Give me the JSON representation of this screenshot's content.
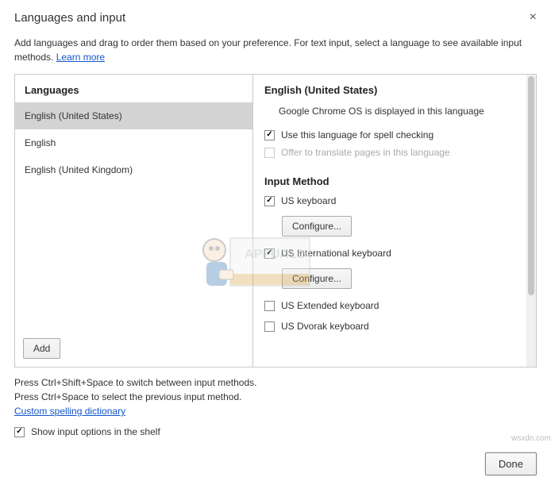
{
  "header": {
    "title": "Languages and input",
    "subtitle_prefix": "Add languages and drag to order them based on your preference. For text input, select a language to see available input methods. ",
    "learn_more": "Learn more"
  },
  "left": {
    "heading": "Languages",
    "items": [
      {
        "label": "English (United States)",
        "selected": true
      },
      {
        "label": "English",
        "selected": false
      },
      {
        "label": "English (United Kingdom)",
        "selected": false
      }
    ],
    "add_label": "Add"
  },
  "right": {
    "title": "English (United States)",
    "display_msg": "Google Chrome OS is displayed in this language",
    "spell_label": "Use this language for spell checking",
    "translate_label": "Offer to translate pages in this language",
    "input_heading": "Input Method",
    "configure_label": "Configure...",
    "methods": [
      {
        "label": "US keyboard",
        "checked": true,
        "configurable": true
      },
      {
        "label": "US International keyboard",
        "checked": true,
        "configurable": true
      },
      {
        "label": "US Extended keyboard",
        "checked": false,
        "configurable": false
      },
      {
        "label": "US Dvorak keyboard",
        "checked": false,
        "configurable": false
      }
    ]
  },
  "footer": {
    "line1": "Press Ctrl+Shift+Space to switch between input methods.",
    "line2": "Press Ctrl+Space to select the previous input method.",
    "dict_link": "Custom spelling dictionary",
    "shelf_label": "Show input options in the shelf",
    "done_label": "Done"
  },
  "credit": "wsxdn.com"
}
